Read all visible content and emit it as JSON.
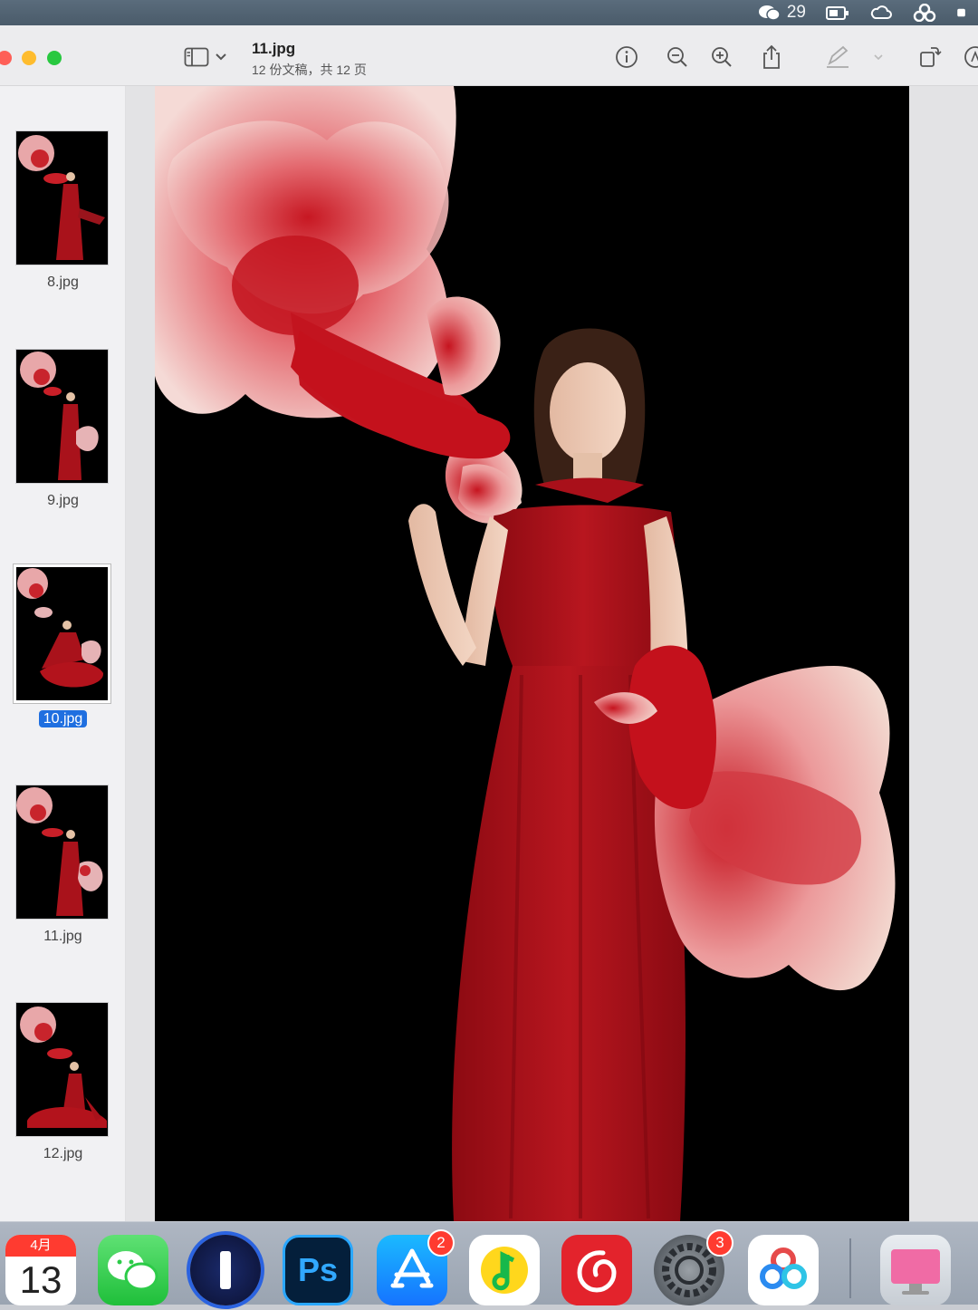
{
  "menubar": {
    "wechat_count": "29",
    "icons": [
      "wechat-icon",
      "battery-status-icon",
      "creative-cloud-icon",
      "baidu-netdisk-icon"
    ]
  },
  "toolbar": {
    "title": "11.jpg",
    "subtitle": "12 份文稿，共 12 页",
    "buttons": [
      "sidebar-toggle-icon",
      "chevron-down-icon",
      "info-icon",
      "zoom-out-icon",
      "zoom-in-icon",
      "share-icon",
      "markup-pen-icon",
      "chevron-down-icon",
      "rotate-icon",
      "annotate-icon"
    ]
  },
  "sidebar": {
    "items": [
      {
        "label": "8.jpg",
        "selected": false
      },
      {
        "label": "9.jpg",
        "selected": false
      },
      {
        "label": "10.jpg",
        "selected": true
      },
      {
        "label": "11.jpg",
        "selected": false
      },
      {
        "label": "12.jpg",
        "selected": false
      }
    ]
  },
  "dock": {
    "calendar": {
      "month": "4月",
      "day": "13"
    },
    "apps": [
      {
        "name": "calendar",
        "badge": ""
      },
      {
        "name": "wechat",
        "badge": ""
      },
      {
        "name": "1password",
        "badge": ""
      },
      {
        "name": "photoshop",
        "label": "Ps",
        "badge": ""
      },
      {
        "name": "app-store",
        "badge": "2"
      },
      {
        "name": "qq-music",
        "badge": ""
      },
      {
        "name": "netease-music",
        "badge": ""
      },
      {
        "name": "system-settings",
        "badge": "3"
      },
      {
        "name": "baidu-netdisk",
        "badge": ""
      },
      {
        "name": "cleanmymac",
        "badge": ""
      }
    ]
  },
  "colors": {
    "dress_red": "#b0141e",
    "selection_blue": "#1f6fe0",
    "badge_red": "#ff3b30"
  }
}
